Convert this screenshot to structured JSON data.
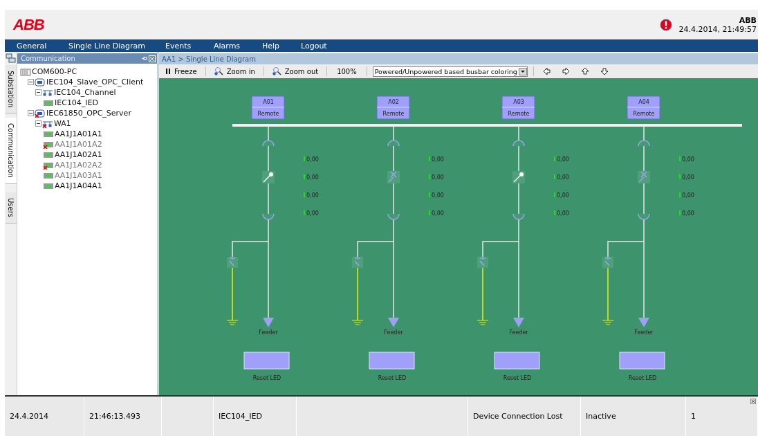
{
  "header": {
    "logo": "ABB",
    "user": "ABB",
    "datetime": "24.4.2014, 21:49:57",
    "alarm": true
  },
  "menu": [
    {
      "label": "General"
    },
    {
      "label": "Single Line Diagram"
    },
    {
      "label": "Events"
    },
    {
      "label": "Alarms"
    },
    {
      "label": "Help"
    },
    {
      "label": "Logout"
    }
  ],
  "side_tabs": [
    {
      "label": "Substation",
      "selected": false
    },
    {
      "label": "Communication",
      "selected": true
    },
    {
      "label": "Users",
      "selected": false
    }
  ],
  "panel": {
    "title": "Communication",
    "tree": [
      {
        "label": "COM600-PC",
        "kind": "computer",
        "error": false,
        "disabled": false,
        "children": [
          {
            "label": "IEC104_Slave_OPC_Client",
            "kind": "opc",
            "error": false,
            "disabled": false,
            "children": [
              {
                "label": "IEC104_Channel",
                "kind": "channel",
                "error": false,
                "disabled": false,
                "children": [
                  {
                    "label": "IEC104_IED",
                    "kind": "ied",
                    "error": false,
                    "disabled": false
                  }
                ]
              }
            ]
          },
          {
            "label": "IEC61850_OPC_Server",
            "kind": "opc",
            "error": true,
            "disabled": false,
            "children": [
              {
                "label": "WA1",
                "kind": "channel",
                "error": true,
                "disabled": false,
                "children": [
                  {
                    "label": "AA1J1A01A1",
                    "kind": "ied",
                    "error": false,
                    "disabled": false
                  },
                  {
                    "label": "AA1J1A01A2",
                    "kind": "ied",
                    "error": true,
                    "disabled": true
                  },
                  {
                    "label": "AA1J1A02A1",
                    "kind": "ied",
                    "error": false,
                    "disabled": false
                  },
                  {
                    "label": "AA1J1A02A2",
                    "kind": "ied",
                    "error": true,
                    "disabled": true
                  },
                  {
                    "label": "AA1J1A03A1",
                    "kind": "ied",
                    "error": false,
                    "disabled": true
                  },
                  {
                    "label": "AA1J1A04A1",
                    "kind": "ied",
                    "error": false,
                    "disabled": false
                  }
                ]
              }
            ]
          }
        ]
      }
    ]
  },
  "breadcrumb": "AA1 > Single Line Diagram",
  "toolbar": {
    "freeze": "Freeze",
    "zoom_in": "Zoom in",
    "zoom_out": "Zoom out",
    "zoom_level": "100%",
    "coloring": "Powered/Unpowered based busbar coloring"
  },
  "feeders": [
    {
      "name": "A01",
      "mode": "Remote",
      "breaker_fault": false,
      "readings": [
        "0,00",
        "0,00",
        "0,00",
        "0,00"
      ],
      "label": "Feeder",
      "button": "Reset LED"
    },
    {
      "name": "A02",
      "mode": "Remote",
      "breaker_fault": true,
      "readings": [
        "0,00",
        "0,00",
        "0,00",
        "0,00"
      ],
      "label": "Feeder",
      "button": "Reset LED"
    },
    {
      "name": "A03",
      "mode": "Remote",
      "breaker_fault": false,
      "readings": [
        "0,00",
        "0,00",
        "0,00",
        "0,00"
      ],
      "label": "Feeder",
      "button": "Reset LED"
    },
    {
      "name": "A04",
      "mode": "Remote",
      "breaker_fault": true,
      "readings": [
        "0,00",
        "0,00",
        "0,00",
        "0,00"
      ],
      "label": "Feeder",
      "button": "Reset LED"
    }
  ],
  "events": [
    {
      "date": "24.4.2014",
      "time": "21:46:13.493",
      "object": "IEC104_IED",
      "message": "Device Connection Lost",
      "state": "Inactive",
      "count": "1"
    }
  ]
}
